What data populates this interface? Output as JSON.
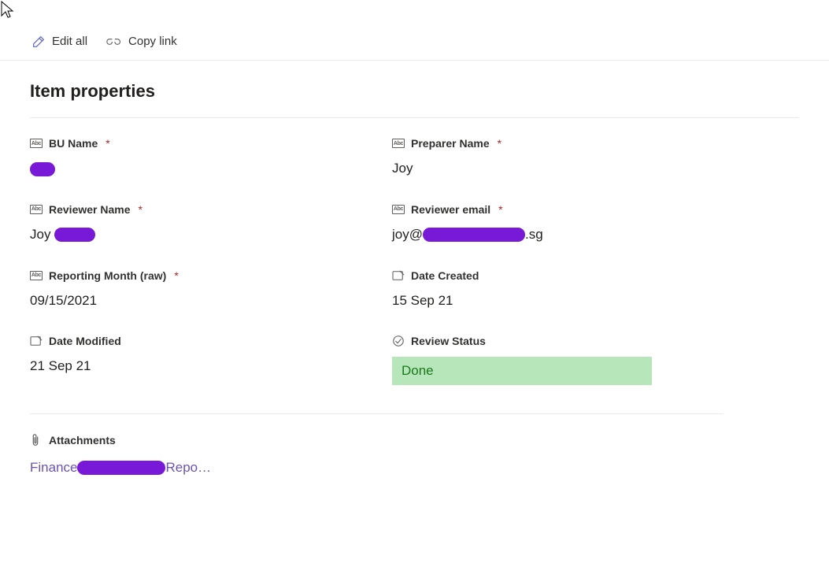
{
  "toolbar": {
    "edit_all_label": "Edit all",
    "copy_link_label": "Copy link"
  },
  "section": {
    "title": "Item properties"
  },
  "fields": {
    "bu_name": {
      "label": "BU Name",
      "required": true,
      "value": ""
    },
    "preparer_name": {
      "label": "Preparer Name",
      "required": true,
      "value": "Joy"
    },
    "reviewer_name": {
      "label": "Reviewer Name",
      "required": true,
      "value_prefix": "Joy "
    },
    "reviewer_email": {
      "label": "Reviewer email",
      "required": true,
      "value_prefix": "joy@",
      "value_suffix": ".sg"
    },
    "reporting_month": {
      "label": "Reporting Month (raw)",
      "required": true,
      "value": "09/15/2021"
    },
    "date_created": {
      "label": "Date Created",
      "required": false,
      "value": "15 Sep 21"
    },
    "date_modified": {
      "label": "Date Modified",
      "required": false,
      "value": "21 Sep 21"
    },
    "review_status": {
      "label": "Review Status",
      "required": false,
      "value": "Done"
    }
  },
  "attachments": {
    "header": "Attachments",
    "item_prefix": "Finance",
    "item_suffix": "Repo…"
  }
}
